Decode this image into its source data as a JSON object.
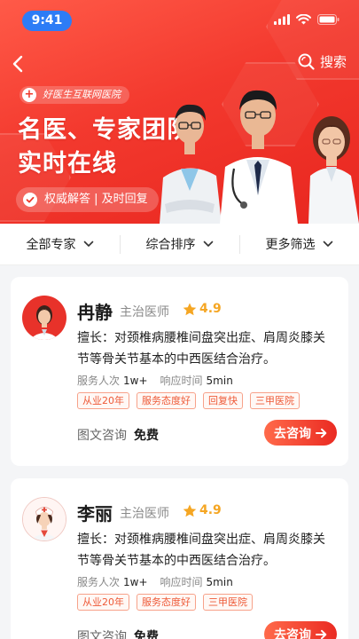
{
  "status_bar": {
    "time": "9:41"
  },
  "nav": {
    "search_label": "搜索"
  },
  "hero": {
    "hospital_tag": "好医生互联网医院",
    "title_line1": "名医、专家团队",
    "title_line2": "实时在线",
    "badge": "权威解答 | 及时回复"
  },
  "filters": [
    {
      "label": "全部专家"
    },
    {
      "label": "综合排序"
    },
    {
      "label": "更多筛选"
    }
  ],
  "doctors": [
    {
      "name": "冉静",
      "title": "主治医师",
      "rating": "4.9",
      "specialty": "擅长：对颈椎病腰椎间盘突出症、肩周炎膝关节等骨关节基本的中西医结合治疗。",
      "service_label": "服务人次",
      "service_value": "1w+",
      "response_label": "响应时间",
      "response_value": "5min",
      "tags": [
        "从业20年",
        "服务态度好",
        "回复快",
        "三甲医院"
      ],
      "consult_label": "图文咨询",
      "consult_price": "免费",
      "button_label": "去咨询"
    },
    {
      "name": "李丽",
      "title": "主治医师",
      "rating": "4.9",
      "specialty": "擅长：对颈椎病腰椎间盘突出症、肩周炎膝关节等骨关节基本的中西医结合治疗。",
      "service_label": "服务人次",
      "service_value": "1w+",
      "response_label": "响应时间",
      "response_value": "5min",
      "tags": [
        "从业20年",
        "服务态度好",
        "三甲医院"
      ],
      "consult_label": "图文咨询",
      "consult_price": "免费",
      "button_label": "去咨询"
    }
  ],
  "colors": {
    "primary": "#f3392e",
    "star": "#f5a623",
    "tag": "#ee5a38"
  }
}
